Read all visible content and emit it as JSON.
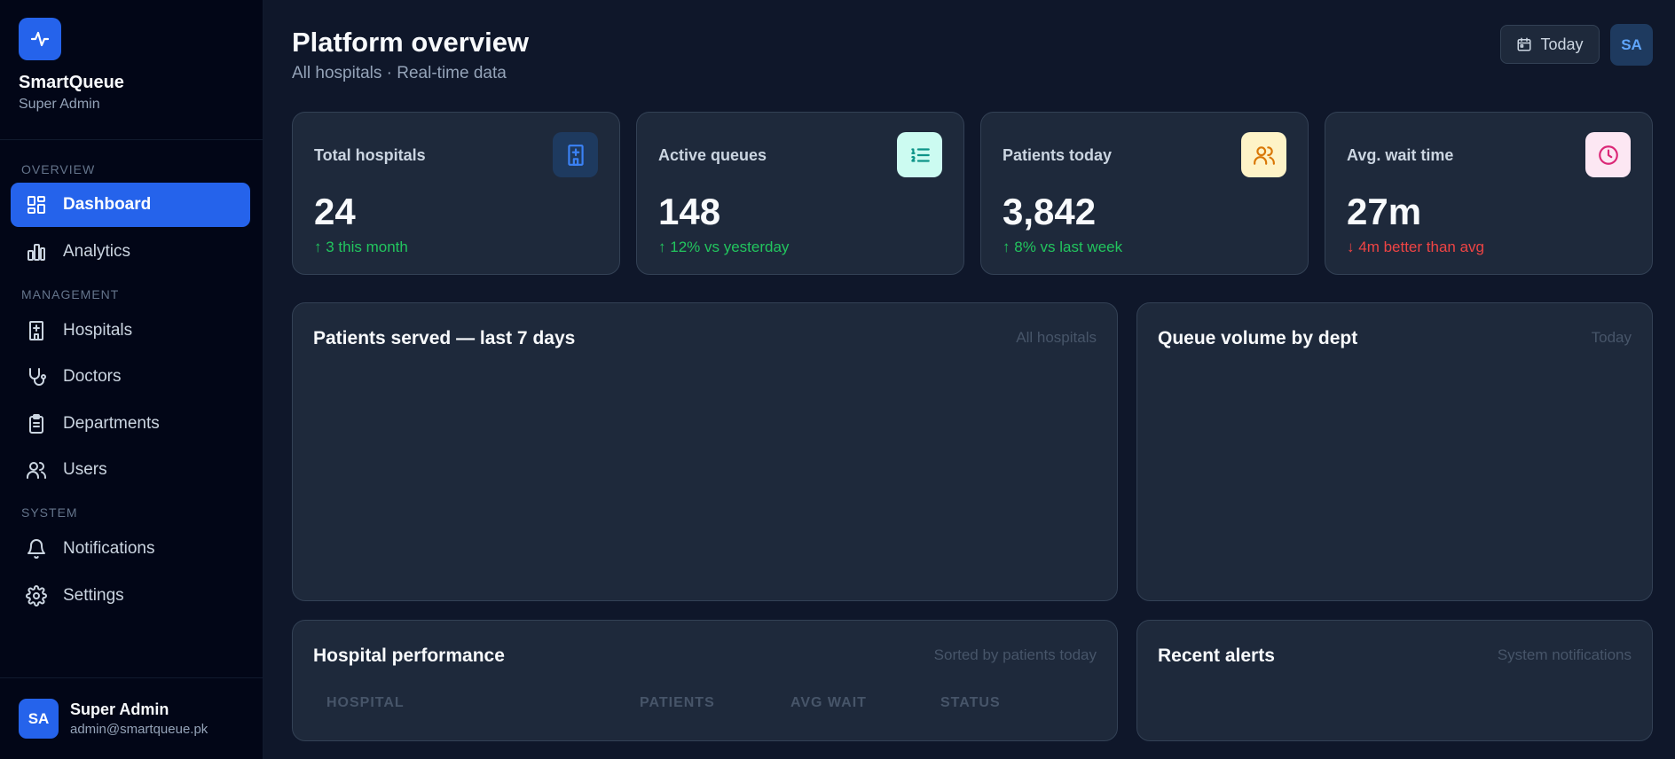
{
  "brand": {
    "name": "SmartQueue",
    "role": "Super Admin",
    "logo_icon": "pulse-icon",
    "accent": "#2563eb"
  },
  "nav": {
    "sections": {
      "overview": "OVERVIEW",
      "management": "MANAGEMENT",
      "system": "SYSTEM"
    },
    "items": [
      {
        "label": "Dashboard",
        "icon": "dashboard-icon",
        "active": true
      },
      {
        "label": "Analytics",
        "icon": "bar-chart-icon",
        "active": false
      },
      {
        "label": "Hospitals",
        "icon": "hospital-icon",
        "active": false
      },
      {
        "label": "Doctors",
        "icon": "stethoscope-icon",
        "active": false
      },
      {
        "label": "Departments",
        "icon": "clipboard-icon",
        "active": false
      },
      {
        "label": "Users",
        "icon": "users-icon",
        "active": false
      },
      {
        "label": "Notifications",
        "icon": "bell-icon",
        "active": false
      },
      {
        "label": "Settings",
        "icon": "gear-icon",
        "active": false
      }
    ]
  },
  "user": {
    "initials": "SA",
    "name": "Super Admin",
    "email": "admin@smartqueue.pk"
  },
  "header": {
    "title": "Platform overview",
    "subtitle": "All hospitals · Real-time data",
    "date_button": "Today",
    "avatar_initials": "SA"
  },
  "stats": [
    {
      "label": "Total hospitals",
      "value": "24",
      "delta": "3 this month",
      "trend": "up",
      "icon": "hospital-icon",
      "icon_color": "#3b82f6",
      "icon_bg": "#1e3a5f"
    },
    {
      "label": "Active queues",
      "value": "148",
      "delta": "12% vs yesterday",
      "trend": "up",
      "icon": "list-ordered-icon",
      "icon_color": "#0d9488",
      "icon_bg": "#ccfbf1"
    },
    {
      "label": "Patients today",
      "value": "3,842",
      "delta": "8% vs last week",
      "trend": "up",
      "icon": "users-icon",
      "icon_color": "#d97706",
      "icon_bg": "#fef3c7"
    },
    {
      "label": "Avg. wait time",
      "value": "27m",
      "delta": "4m better than avg",
      "trend": "down",
      "icon": "clock-icon",
      "icon_color": "#db2777",
      "icon_bg": "#fce7f3"
    }
  ],
  "panels": {
    "patients_served": {
      "title": "Patients served — last 7 days",
      "meta": "All hospitals"
    },
    "queue_volume": {
      "title": "Queue volume by dept",
      "meta": "Today"
    },
    "hospital_performance": {
      "title": "Hospital performance",
      "meta": "Sorted by patients today",
      "columns": [
        "HOSPITAL",
        "PATIENTS",
        "AVG WAIT",
        "STATUS"
      ]
    },
    "recent_alerts": {
      "title": "Recent alerts",
      "meta": "System notifications"
    }
  }
}
